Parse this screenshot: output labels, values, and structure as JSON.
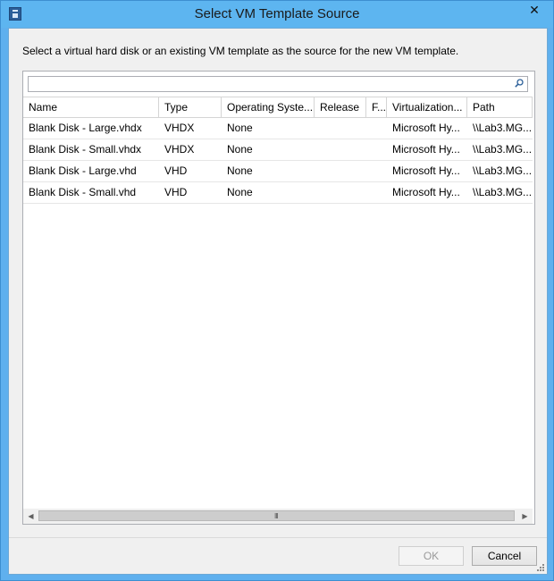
{
  "window": {
    "title": "Select VM Template Source",
    "close_glyph": "✕"
  },
  "instruction": "Select a virtual hard disk or an existing VM template as the source for the new VM template.",
  "search": {
    "value": "",
    "placeholder": ""
  },
  "table": {
    "columns": [
      "Name",
      "Type",
      "Operating Syste...",
      "Release",
      "F...",
      "Virtualization...",
      "Path"
    ],
    "rows": [
      [
        "Blank Disk - Large.vhdx",
        "VHDX",
        "None",
        "",
        "",
        "Microsoft Hy...",
        "\\\\Lab3.MG..."
      ],
      [
        "Blank Disk - Small.vhdx",
        "VHDX",
        "None",
        "",
        "",
        "Microsoft Hy...",
        "\\\\Lab3.MG..."
      ],
      [
        "Blank Disk - Large.vhd",
        "VHD",
        "None",
        "",
        "",
        "Microsoft Hy...",
        "\\\\Lab3.MG..."
      ],
      [
        "Blank Disk - Small.vhd",
        "VHD",
        "None",
        "",
        "",
        "Microsoft Hy...",
        "\\\\Lab3.MG..."
      ]
    ]
  },
  "scrollbar": {
    "left_glyph": "◀",
    "right_glyph": "▶",
    "grip_glyph": "III"
  },
  "buttons": {
    "ok": "OK",
    "cancel": "Cancel"
  },
  "icons": [
    "app-icon",
    "close-icon",
    "search-icon",
    "scroll-left-icon",
    "scroll-right-icon",
    "resize-grip-icon"
  ]
}
